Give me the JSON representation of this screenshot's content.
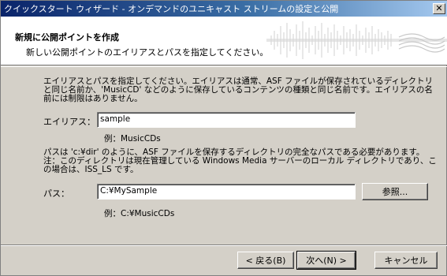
{
  "window": {
    "title": "クイックスタート ウィザード - オンデマンドのユニキャスト ストリームの設定と公開",
    "close_glyph": "✕"
  },
  "header": {
    "title": "新規に公開ポイントを作成",
    "subtitle": "新しい公開ポイントのエイリアスとパスを指定してください。"
  },
  "alias_section": {
    "description": "エイリアスとパスを指定してください。エイリアスは通常、ASF ファイルが保存されているディレクトリと同じ名前か、'MusicCD' などのように保存しているコンテンツの種類と同じ名前です。エイリアスの名前には制限はありません。",
    "label": "エイリアス：",
    "value": "sample",
    "example": "例：MusicCDs"
  },
  "path_section": {
    "description": "パスは 'c:¥dir' のように、ASF ファイルを保存するディレクトリの完全なパスである必要があります。注：このディレクトリは現在管理している Windows Media サーバーのローカル ディレクトリであり、この場合は、ISS_LS です。",
    "label": "パス：",
    "value": "C:¥MySample",
    "browse_button": "参照...",
    "example": "例：C:¥MusicCDs"
  },
  "footer": {
    "back_button": "< 戻る(B)",
    "next_button": "次へ(N) >",
    "cancel_button": "キャンセル"
  }
}
